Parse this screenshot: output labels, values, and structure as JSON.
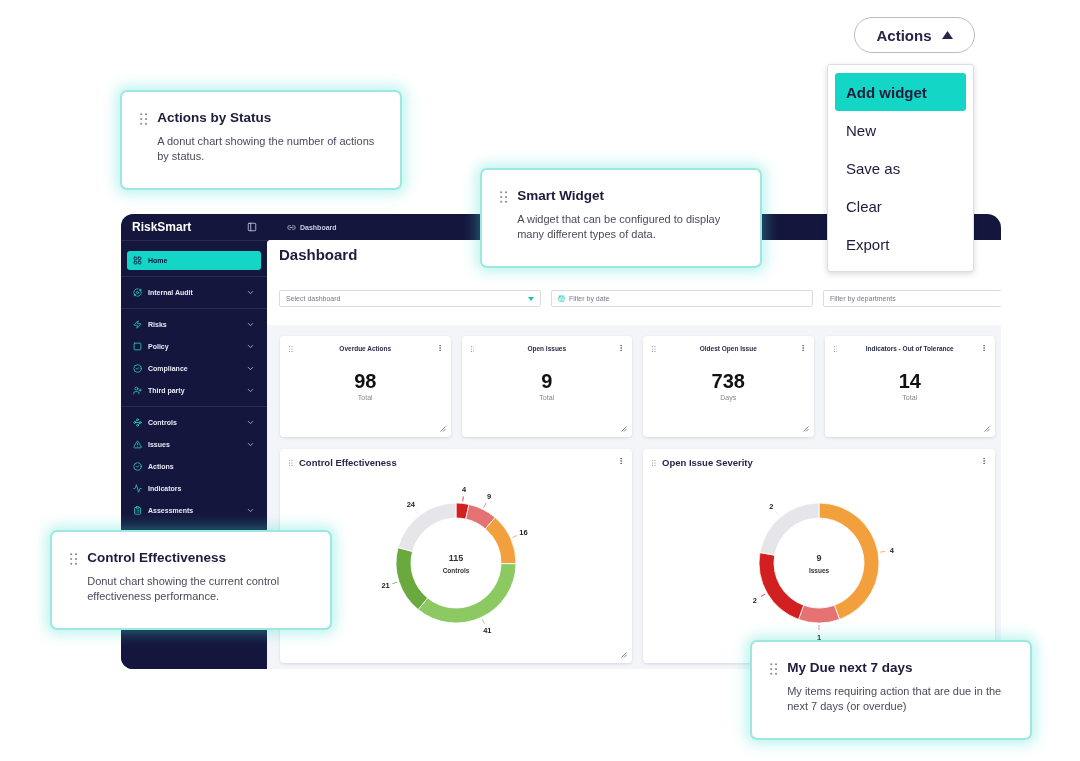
{
  "actions_button": {
    "label": "Actions",
    "expanded": true
  },
  "actions_menu": [
    {
      "label": "Add widget",
      "selected": true
    },
    {
      "label": "New",
      "selected": false
    },
    {
      "label": "Save as",
      "selected": false
    },
    {
      "label": "Clear",
      "selected": false
    },
    {
      "label": "Export",
      "selected": false
    }
  ],
  "app": {
    "brand": "RiskSmart",
    "breadcrumb": "Dashboard",
    "sidebar": {
      "sections": [
        {
          "items": [
            {
              "label": "Home",
              "selected": true,
              "expandable": false
            }
          ]
        },
        {
          "items": [
            {
              "label": "Internal Audit",
              "selected": false,
              "expandable": true
            }
          ]
        },
        {
          "items": [
            {
              "label": "Risks",
              "selected": false,
              "expandable": true
            },
            {
              "label": "Policy",
              "selected": false,
              "expandable": true
            },
            {
              "label": "Compliance",
              "selected": false,
              "expandable": true
            },
            {
              "label": "Third party",
              "selected": false,
              "expandable": true
            }
          ]
        },
        {
          "items": [
            {
              "label": "Controls",
              "selected": false,
              "expandable": true
            },
            {
              "label": "Issues",
              "selected": false,
              "expandable": true
            },
            {
              "label": "Actions",
              "selected": false,
              "expandable": false
            },
            {
              "label": "Indicators",
              "selected": false,
              "expandable": false
            },
            {
              "label": "Assessments",
              "selected": false,
              "expandable": true
            }
          ]
        }
      ]
    },
    "page_title": "Dashboard",
    "filters": [
      {
        "kind": "select",
        "placeholder": "Select dashboard"
      },
      {
        "kind": "date",
        "placeholder": "Filter by date"
      },
      {
        "kind": "text",
        "placeholder": "Filter by departments"
      }
    ],
    "stat_cards": [
      {
        "title": "Overdue Actions",
        "value": "98",
        "unit": "Total"
      },
      {
        "title": "Open Issues",
        "value": "9",
        "unit": "Total"
      },
      {
        "title": "Oldest Open Issue",
        "value": "738",
        "unit": "Days"
      },
      {
        "title": "Indicators - Out of Tolerance",
        "value": "14",
        "unit": "Total"
      }
    ],
    "chart_cards": [
      {
        "title": "Control Effectiveness",
        "center_value": "115",
        "center_label": "Controls",
        "chart_data": {
          "type": "donut",
          "values": [
            4,
            9,
            16,
            41,
            21,
            24
          ],
          "colors": [
            "#d21f1f",
            "#e57373",
            "#f2a03d",
            "#8cc962",
            "#6aa93e",
            "#e6e6ea"
          ],
          "data_labels": true
        }
      },
      {
        "title": "Open Issue Severity",
        "center_value": "9",
        "center_label": "Issues",
        "chart_data": {
          "type": "donut",
          "values": [
            4,
            1,
            2,
            2
          ],
          "colors": [
            "#f2a03d",
            "#e57373",
            "#d21f1f",
            "#e6e6ea"
          ],
          "data_labels": true
        }
      }
    ]
  },
  "callouts": [
    {
      "title": "Actions by Status",
      "description": "A donut chart showing the number of actions by status."
    },
    {
      "title": "Smart Widget",
      "description": "A widget that can be configured to display many different types of data."
    },
    {
      "title": "Control Effectiveness",
      "description": "Donut chart showing the current control effectiveness performance."
    },
    {
      "title": "My Due next 7 days",
      "description": "My items requiring action that are due in the next 7 days (or overdue)"
    }
  ]
}
